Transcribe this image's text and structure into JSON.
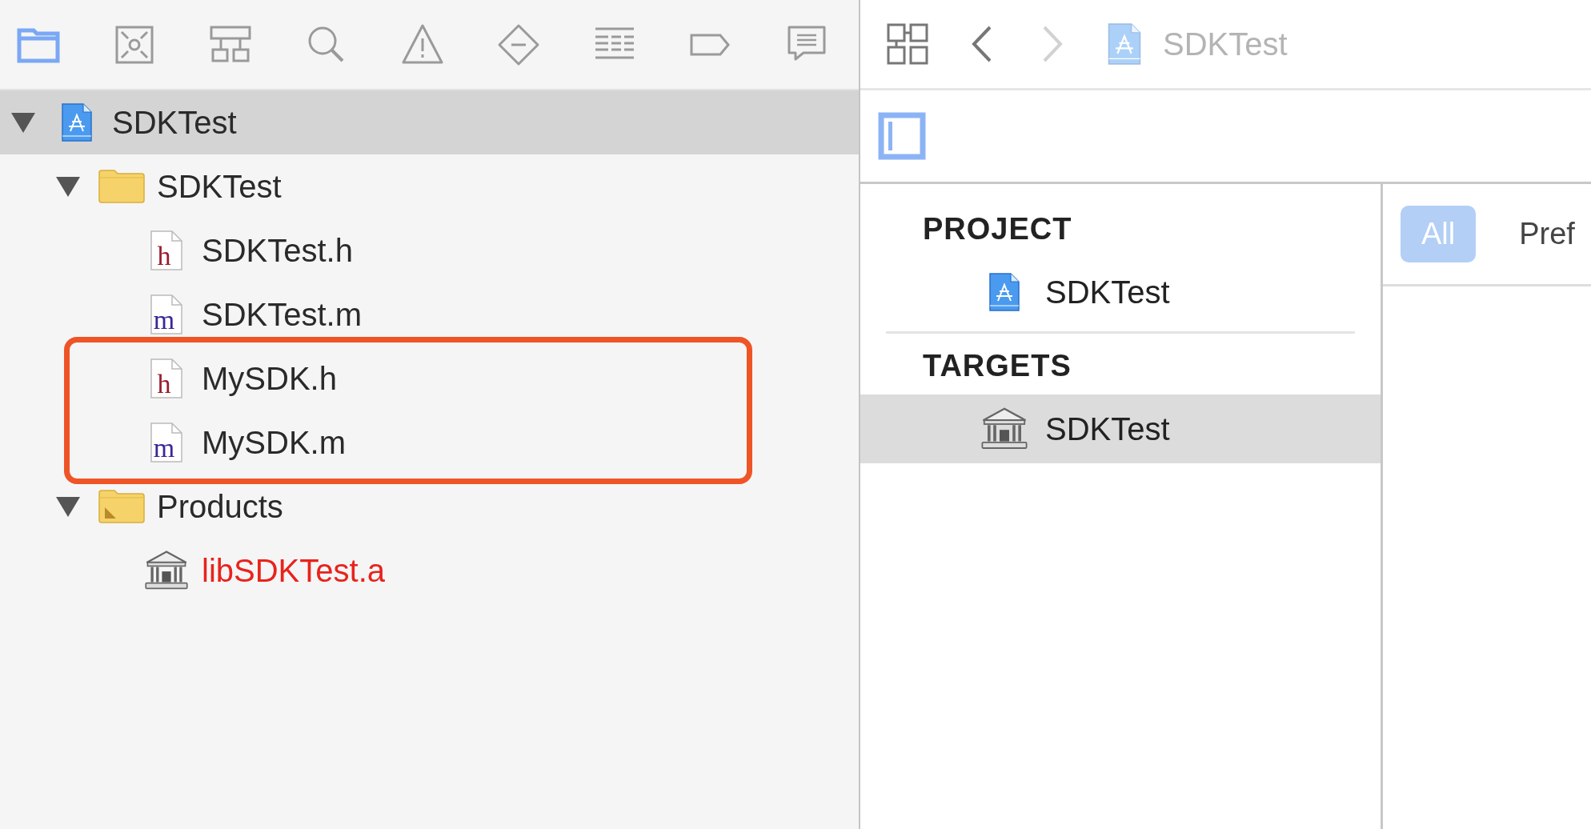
{
  "navigator_toolbar": {
    "icons": [
      {
        "kind": "folder",
        "selected": true
      },
      {
        "kind": "source-control",
        "selected": false
      },
      {
        "kind": "hierarchy",
        "selected": false
      },
      {
        "kind": "search",
        "selected": false
      },
      {
        "kind": "warning",
        "selected": false
      },
      {
        "kind": "test",
        "selected": false
      },
      {
        "kind": "debug",
        "selected": false
      },
      {
        "kind": "breakpoint",
        "selected": false
      },
      {
        "kind": "report",
        "selected": false
      }
    ]
  },
  "tree": [
    {
      "name": "SDKTest",
      "kind": "project",
      "expanded": true,
      "selected": true,
      "children": [
        {
          "name": "SDKTest",
          "kind": "folder",
          "expanded": true,
          "selected": false,
          "children": [
            {
              "name": "SDKTest.h",
              "kind": "file",
              "badge": "h",
              "color": "#9b1c2b",
              "selected": false,
              "highlighted": false
            },
            {
              "name": "SDKTest.m",
              "kind": "file",
              "badge": "m",
              "color": "#3c2596",
              "selected": false,
              "highlighted": false
            },
            {
              "name": "MySDK.h",
              "kind": "file",
              "badge": "h",
              "color": "#9b1c2b",
              "selected": false,
              "highlighted": true
            },
            {
              "name": "MySDK.m",
              "kind": "file",
              "badge": "m",
              "color": "#3c2596",
              "selected": false,
              "highlighted": true
            }
          ]
        },
        {
          "name": "Products",
          "kind": "products-folder",
          "expanded": true,
          "selected": false,
          "children": [
            {
              "name": "libSDKTest.a",
              "kind": "library",
              "missing": true,
              "selected": false
            }
          ]
        }
      ]
    }
  ],
  "editor": {
    "jump_bar": {
      "back_enabled": true,
      "forward_enabled": false,
      "path": "SDKTest"
    },
    "sidebar_toggle": {
      "on": true
    },
    "sections": [
      {
        "header": "PROJECT",
        "items": [
          {
            "name": "SDKTest",
            "kind": "project",
            "selected": false
          }
        ]
      },
      {
        "header": "TARGETS",
        "items": [
          {
            "name": "SDKTest",
            "kind": "library",
            "selected": true
          }
        ]
      }
    ],
    "tabs": [
      {
        "label": "All",
        "selected": true
      },
      {
        "label": "Pref",
        "selected": false
      }
    ]
  }
}
